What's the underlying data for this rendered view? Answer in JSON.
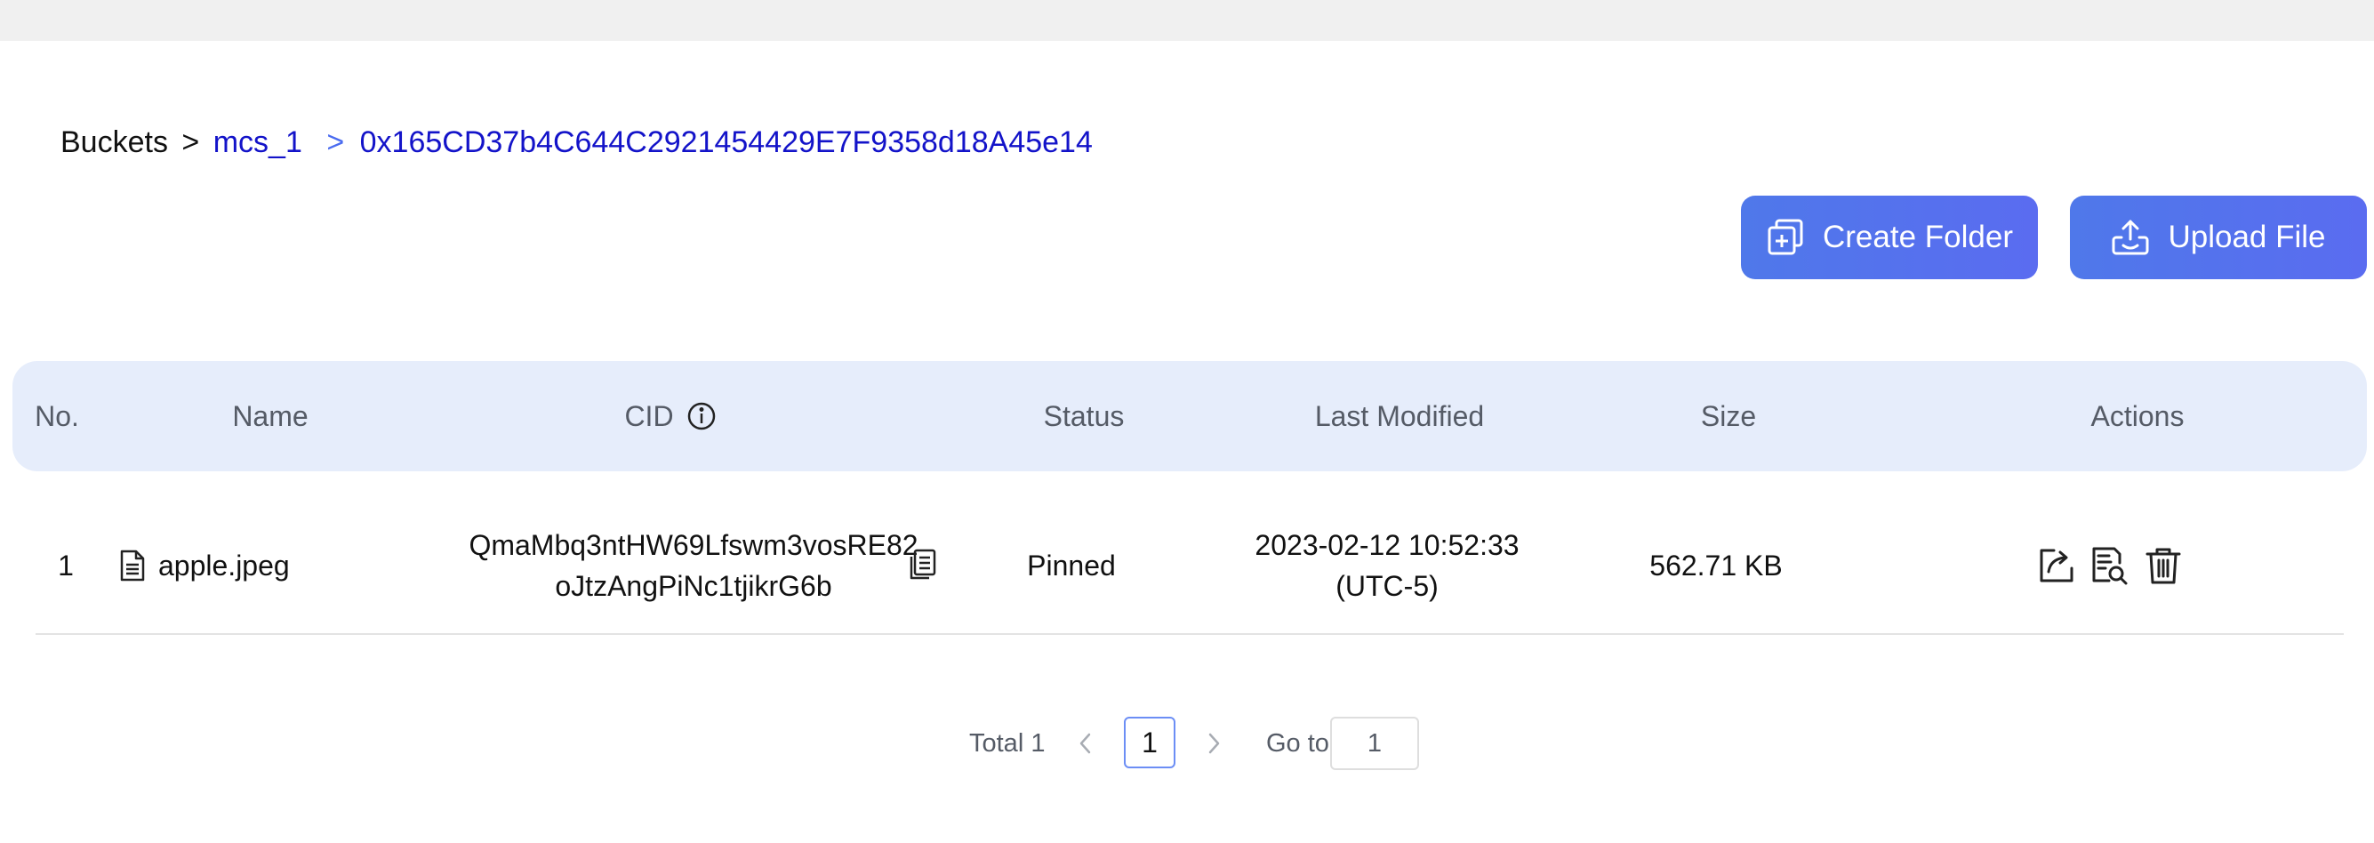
{
  "breadcrumb": {
    "root": "Buckets",
    "sep": ">",
    "bucket": "mcs_1",
    "sep2": ">",
    "current": "0x165CD37b4C644C2921454429E7F9358d18A45e14"
  },
  "toolbar": {
    "create_folder_label": "Create Folder",
    "upload_file_label": "Upload File"
  },
  "table": {
    "headers": {
      "no": "No.",
      "name": "Name",
      "cid": "CID",
      "status": "Status",
      "last_modified": "Last Modified",
      "size": "Size",
      "actions": "Actions"
    },
    "rows": [
      {
        "no": "1",
        "name": "apple.jpeg",
        "cid_line1": "QmaMbq3ntHW69Lfswm3vosRE82",
        "cid_line2": "oJtzAngPiNc1tjikrG6b",
        "status": "Pinned",
        "modified_line1": "2023-02-12 10:52:33",
        "modified_line2": "(UTC-5)",
        "size": "562.71 KB"
      }
    ]
  },
  "pagination": {
    "total_label": "Total 1",
    "current_page": "1",
    "goto_label": "Go to",
    "goto_value": "1"
  },
  "colors": {
    "accent": "#5a72ee",
    "link": "#1313c9",
    "header_bg": "#e6edfb",
    "topbar_bg": "#f0f0f0"
  },
  "icons": {
    "create_folder": "folder-plus-icon",
    "upload_file": "upload-icon",
    "cid_info": "info-icon",
    "file": "file-icon",
    "copy": "copy-icon",
    "share": "share-icon",
    "preview": "file-search-icon",
    "delete": "trash-icon",
    "prev": "chevron-left-icon",
    "next": "chevron-right-icon"
  }
}
